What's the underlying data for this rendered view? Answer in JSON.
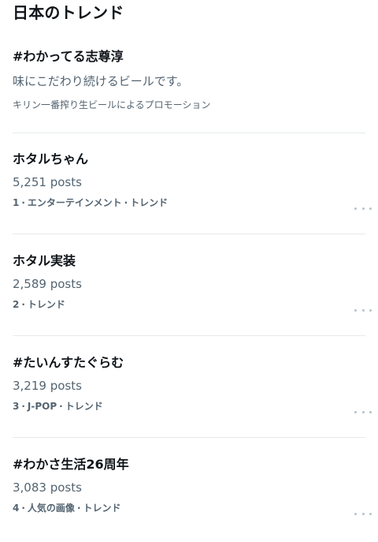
{
  "header": {
    "title": "日本のトレンド"
  },
  "promo": {
    "title": "#わかってる志尊淳",
    "description": "味にこだわり続けるビールです。",
    "promoted_by": "キリン一番搾り生ビールによるプロモーション"
  },
  "trends": [
    {
      "name": "ホタルちゃん",
      "posts": "5,251 posts",
      "rank": "1",
      "category": "エンターテインメント",
      "label": "トレンド"
    },
    {
      "name": "ホタル実装",
      "posts": "2,589 posts",
      "rank": "2",
      "label": "トレンド"
    },
    {
      "name": "#たいんすたぐらむ",
      "posts": "3,219 posts",
      "rank": "3",
      "category": "J-POP",
      "label": "トレンド"
    },
    {
      "name": "#わかさ生活26周年",
      "posts": "3,083 posts",
      "rank": "4",
      "category": "人気の画像",
      "label": "トレンド"
    }
  ],
  "meta_separator": "·",
  "colors": {
    "text_primary": "#0f1419",
    "text_secondary": "#536471",
    "divider": "#e6e9eb"
  },
  "icons": {
    "more": "more-horizontal-icon"
  }
}
